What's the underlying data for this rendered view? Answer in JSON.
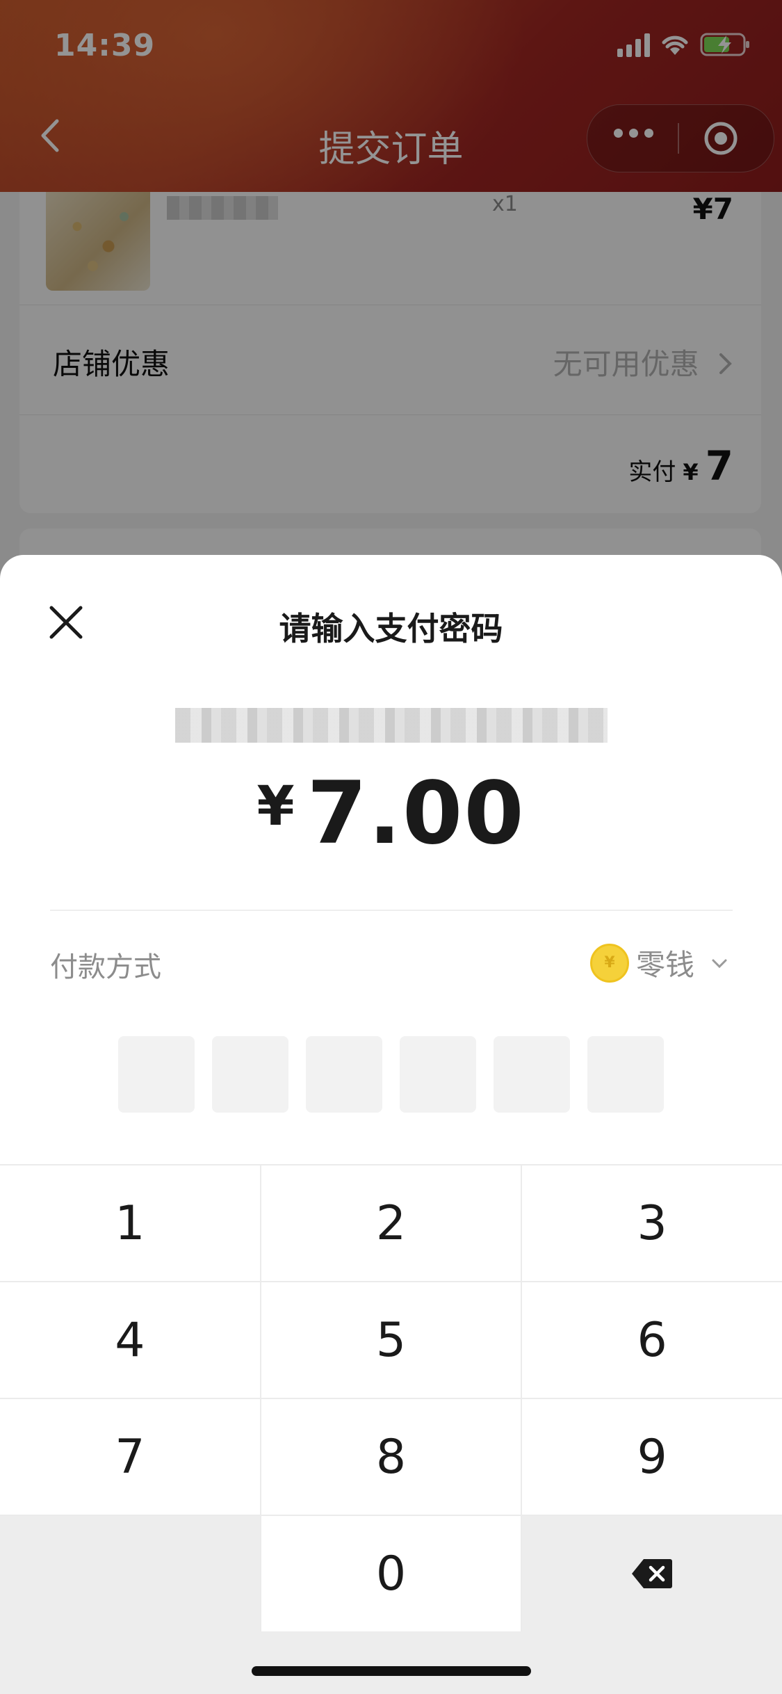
{
  "status_bar": {
    "time": "14:39"
  },
  "nav": {
    "title": "提交订单"
  },
  "order": {
    "quantity": "x1",
    "item_price": "¥7",
    "discount_label": "店铺优惠",
    "discount_value": "无可用优惠",
    "paid_label": "实付",
    "paid_currency": "¥",
    "paid_amount": "7"
  },
  "payment_sheet": {
    "title": "请输入支付密码",
    "currency": "¥",
    "amount": "7.00",
    "method_label": "付款方式",
    "method_value": "零钱",
    "method_coin_symbol": "¥",
    "password_length": 6
  },
  "keypad": {
    "rows": [
      [
        "1",
        "2",
        "3"
      ],
      [
        "4",
        "5",
        "6"
      ],
      [
        "7",
        "8",
        "9"
      ],
      [
        "",
        "0",
        "⌫"
      ]
    ]
  },
  "colors": {
    "header_red": "#a02622",
    "coin_yellow": "#f5d13a",
    "text_dark": "#1a1a1a",
    "text_gray": "#8c8c8c"
  }
}
